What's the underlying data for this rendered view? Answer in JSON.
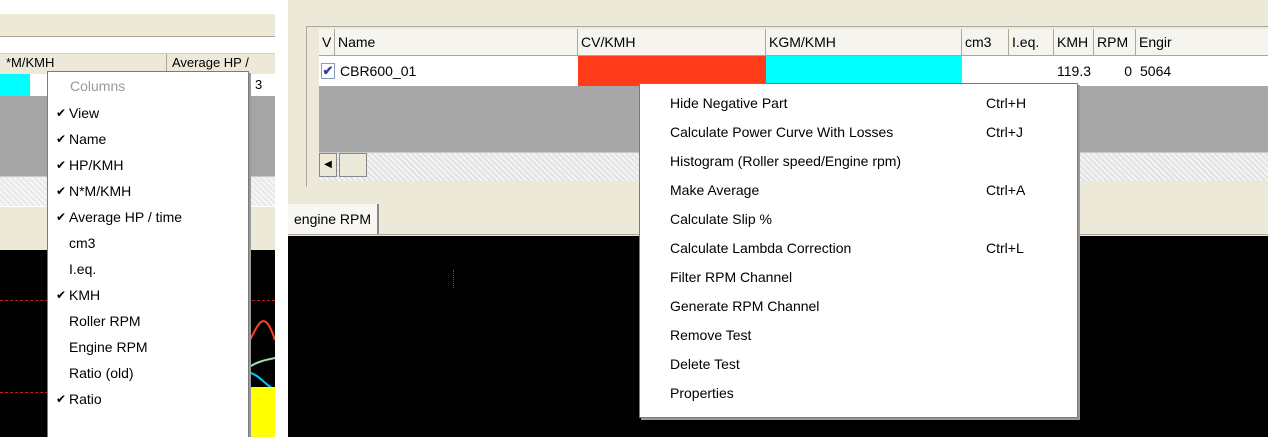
{
  "left_grid": {
    "header_col1": "*M/KMH",
    "header_col2": "Average HP /",
    "row_value": "3",
    "row_color": "#00ffff"
  },
  "columns_menu": {
    "heading": "Columns",
    "items": [
      {
        "label": "View",
        "checked": true
      },
      {
        "label": "Name",
        "checked": true
      },
      {
        "label": "HP/KMH",
        "checked": true
      },
      {
        "label": "N*M/KMH",
        "checked": true
      },
      {
        "label": "Average HP / time",
        "checked": true
      },
      {
        "label": "cm3",
        "checked": false
      },
      {
        "label": "I.eq.",
        "checked": false
      },
      {
        "label": "KMH",
        "checked": true
      },
      {
        "label": "Roller RPM",
        "checked": false
      },
      {
        "label": "Engine RPM",
        "checked": false
      },
      {
        "label": "Ratio (old)",
        "checked": false
      },
      {
        "label": "Ratio",
        "checked": true
      }
    ]
  },
  "grid": {
    "columns": [
      "V",
      "Name",
      "CV/KMH",
      "KGM/KMH",
      "cm3",
      "I.eq.",
      "KMH",
      "RPM",
      "Engir"
    ],
    "row": {
      "name": "CBR600_01",
      "kmh": "119.3",
      "rpm": "0",
      "engine": "5064",
      "cv_color": "#ff3b1a",
      "kgm_color": "#00ffff"
    }
  },
  "tab": {
    "label": "engine RPM"
  },
  "context_menu": {
    "items": [
      {
        "label": "Hide Negative Part",
        "shortcut": "Ctrl+H"
      },
      {
        "label": "Calculate Power Curve With Losses",
        "shortcut": "Ctrl+J"
      },
      {
        "label": "Histogram (Roller speed/Engine rpm)",
        "shortcut": ""
      },
      {
        "label": "Make Average",
        "shortcut": "Ctrl+A"
      },
      {
        "label": "Calculate Slip %",
        "shortcut": ""
      },
      {
        "label": "Calculate Lambda Correction",
        "shortcut": "Ctrl+L"
      },
      {
        "label": "Filter RPM Channel",
        "shortcut": ""
      },
      {
        "label": "Generate RPM Channel",
        "shortcut": ""
      },
      {
        "label": "Remove Test",
        "shortcut": ""
      },
      {
        "label": "Delete Test",
        "shortcut": ""
      },
      {
        "label": "Properties",
        "shortcut": ""
      }
    ]
  },
  "icons": {
    "check": "checkmark-icon",
    "scroll_left": "arrow-left-icon"
  }
}
